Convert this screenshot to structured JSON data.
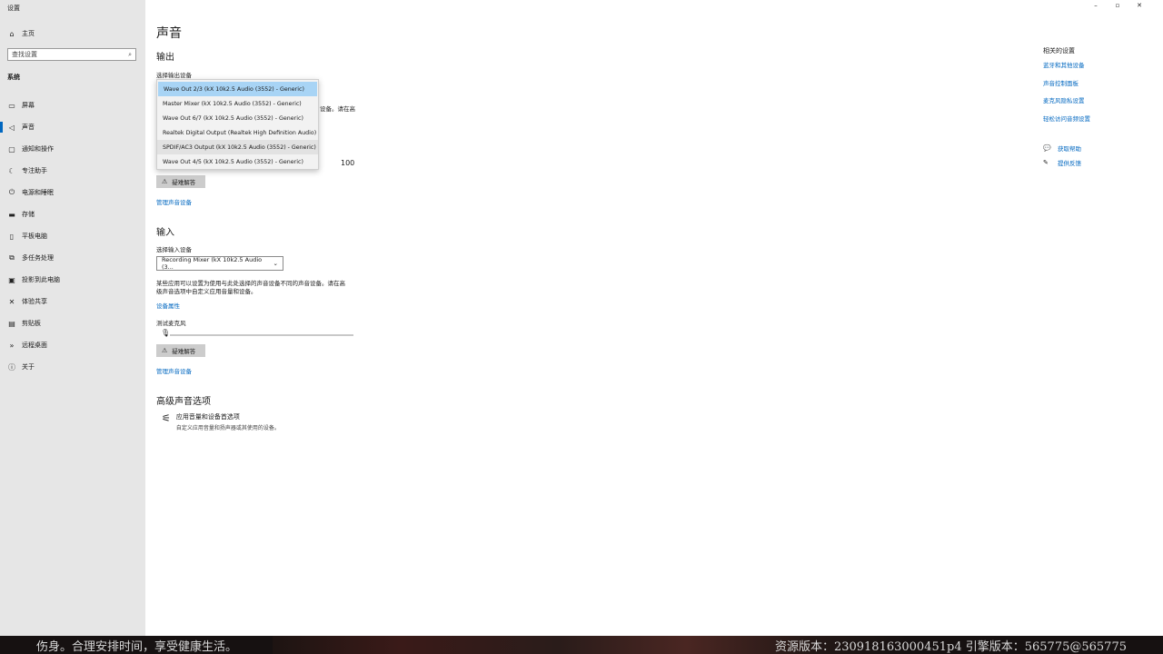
{
  "window": {
    "title": "设置",
    "controls": {
      "minimize": "–",
      "maximize": "▫",
      "close": "✕"
    }
  },
  "sidebar": {
    "home_label": "主页",
    "search_placeholder": "查找设置",
    "section": "系统",
    "items": [
      {
        "label": "屏幕",
        "icon": "monitor-icon"
      },
      {
        "label": "声音",
        "icon": "speaker-icon",
        "active": true
      },
      {
        "label": "通知和操作",
        "icon": "notification-icon"
      },
      {
        "label": "专注助手",
        "icon": "moon-icon"
      },
      {
        "label": "电源和睡眠",
        "icon": "power-icon"
      },
      {
        "label": "存储",
        "icon": "storage-icon"
      },
      {
        "label": "平板电脑",
        "icon": "tablet-icon"
      },
      {
        "label": "多任务处理",
        "icon": "multitask-icon"
      },
      {
        "label": "投影到此电脑",
        "icon": "projector-icon"
      },
      {
        "label": "体验共享",
        "icon": "share-icon"
      },
      {
        "label": "剪贴板",
        "icon": "clipboard-icon"
      },
      {
        "label": "远程桌面",
        "icon": "remote-icon"
      },
      {
        "label": "关于",
        "icon": "info-icon"
      }
    ]
  },
  "main": {
    "title": "声音",
    "output": {
      "heading": "输出",
      "select_label": "选择输出设备",
      "desc_fragment": "设备。请在高",
      "volume_value": "100",
      "troubleshoot": "疑难解答",
      "manage_link": "管理声音设备"
    },
    "output_dropdown": {
      "options": [
        "Wave Out 2/3 (kX 10k2.5 Audio (3552) - Generic)",
        "Master Mixer (kX 10k2.5 Audio (3552) - Generic)",
        "Wave Out 6/7 (kX 10k2.5 Audio (3552) - Generic)",
        "Realtek Digital Output (Realtek High Definition Audio)",
        "SPDIF/AC3 Output (kX 10k2.5 Audio (3552) - Generic)",
        "Wave Out 4/5 (kX 10k2.5 Audio (3552) - Generic)"
      ],
      "selected_index": 0,
      "hover_index": 4
    },
    "input": {
      "heading": "输入",
      "select_label": "选择输入设备",
      "selected_device": "Recording Mixer (kX 10k2.5 Audio (3...",
      "desc_line1": "某些应用可以设置为使用与此处选择的声音设备不同的声音设备。请在高",
      "desc_line2": "级声音选项中自定义应用音量和设备。",
      "properties_link": "设备属性",
      "test_mic_label": "测试麦克风",
      "troubleshoot": "疑难解答",
      "manage_link": "管理声音设备"
    },
    "advanced": {
      "heading": "高级声音选项",
      "item_title": "应用音量和设备首选项",
      "item_desc": "自定义应用音量和扬声器或其使用的设备。"
    }
  },
  "related": {
    "title": "相关的设置",
    "links": [
      "蓝牙和其他设备",
      "声音控制面板",
      "麦克风隐私设置",
      "轻松访问音频设置"
    ]
  },
  "help": {
    "get_help": "获取帮助",
    "feedback": "提供反馈"
  },
  "banner": {
    "left_text": "伤身。合理安排时间，享受健康生活。",
    "right_text": "资源版本：23091816300045‌1p4 引擎版本：565775@565775"
  }
}
